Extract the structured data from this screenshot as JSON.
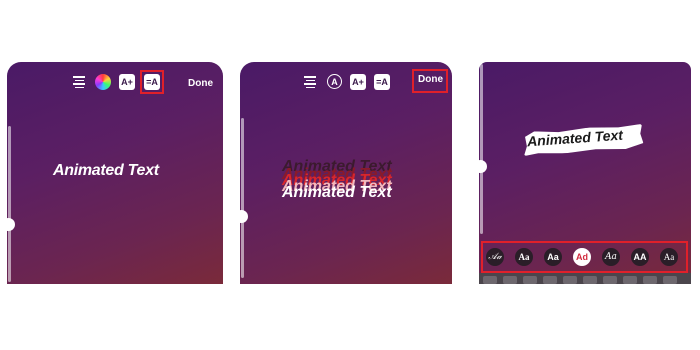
{
  "panel1": {
    "toolbar": {
      "text_style_glyph": "A+",
      "animate_glyph": "=A"
    },
    "done_label": "Done",
    "text": "Animated Text"
  },
  "panel2": {
    "toolbar": {
      "circle_glyph": "A",
      "text_style_glyph": "A+",
      "animate_glyph": "=A"
    },
    "done_label": "Done",
    "text": "Animated Text"
  },
  "panel3": {
    "text": "Animated Text",
    "fonts": [
      "𝒜𝒶",
      "Aa",
      "Aa",
      "Ad",
      "Aa",
      "AA",
      "Aa"
    ],
    "selected_font_index": 3
  },
  "colors": {
    "highlight": "#e0202a"
  }
}
